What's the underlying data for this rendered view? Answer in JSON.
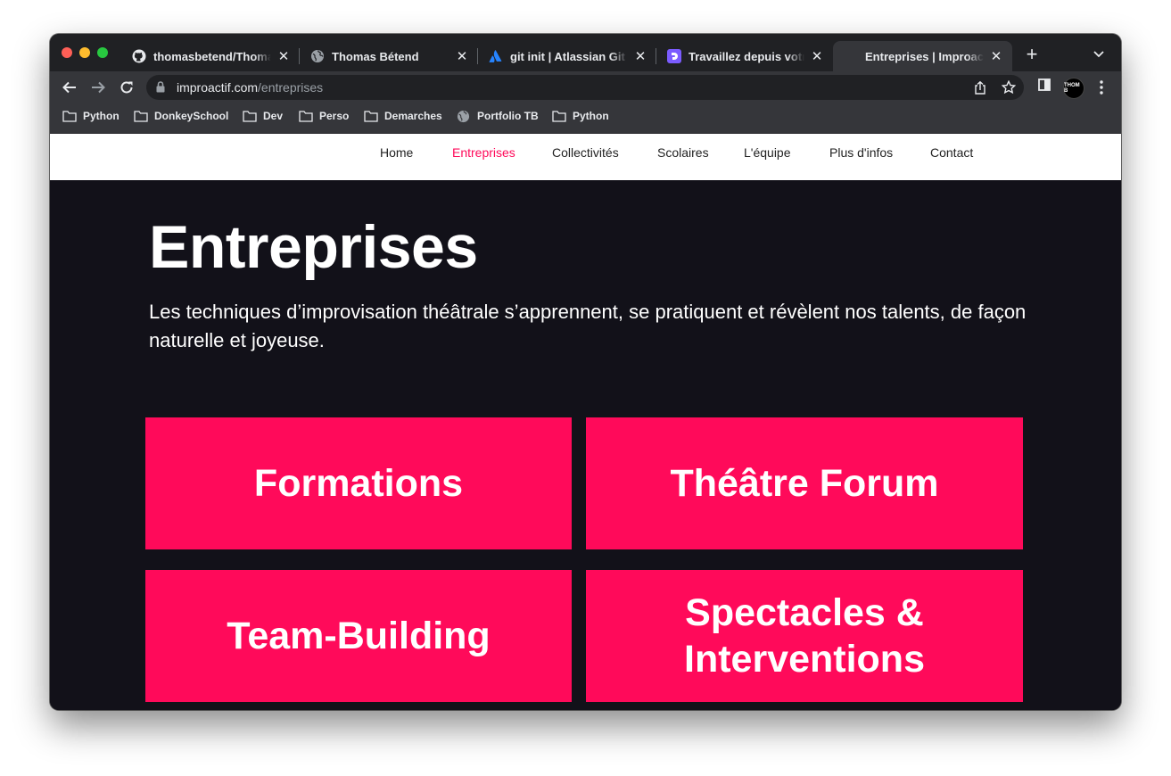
{
  "browser": {
    "tabs": [
      {
        "title": "thomasbetend/ThomasBetend",
        "icon": "github-icon",
        "active": false
      },
      {
        "title": "Thomas Bétend",
        "icon": "globe-icon",
        "active": false
      },
      {
        "title": "git init | Atlassian Git Tutorial",
        "icon": "atlassian-icon",
        "active": false
      },
      {
        "title": "Travaillez depuis votre dépôt",
        "icon": "app-icon",
        "active": false
      },
      {
        "title": "Entreprises | Improactif",
        "icon": "",
        "active": true
      }
    ],
    "url_host": "improactif.com",
    "url_path": "/entreprises",
    "avatar_text": "THOM B",
    "bookmarks": [
      {
        "label": "Python",
        "icon": "folder-icon"
      },
      {
        "label": "DonkeySchool",
        "icon": "folder-icon"
      },
      {
        "label": "Dev",
        "icon": "folder-icon"
      },
      {
        "label": "Perso",
        "icon": "folder-icon"
      },
      {
        "label": "Demarches",
        "icon": "folder-icon"
      },
      {
        "label": "Portfolio TB",
        "icon": "globe-icon"
      },
      {
        "label": "Python",
        "icon": "folder-icon"
      }
    ]
  },
  "site": {
    "nav": [
      {
        "label": "Home"
      },
      {
        "label": "Entreprises",
        "current": true
      },
      {
        "label": "Collectivités"
      },
      {
        "label": "Scolaires"
      },
      {
        "label": "L'équipe"
      },
      {
        "label": "Plus d'infos"
      },
      {
        "label": "Contact"
      }
    ],
    "title": "Entreprises",
    "subtitle": "Les techniques d’improvisation théâtrale s’apprennent, se pratiquent et révèlent nos talents, de façon naturelle et joyeuse.",
    "cards": [
      {
        "label": "Formations"
      },
      {
        "label": "Théâtre Forum"
      },
      {
        "label": "Team-Building"
      },
      {
        "label": "Spectacles & Interventions"
      }
    ]
  },
  "colors": {
    "accent": "#ff0a5a",
    "page_background": "#121119",
    "browser_chrome": "#202124"
  }
}
